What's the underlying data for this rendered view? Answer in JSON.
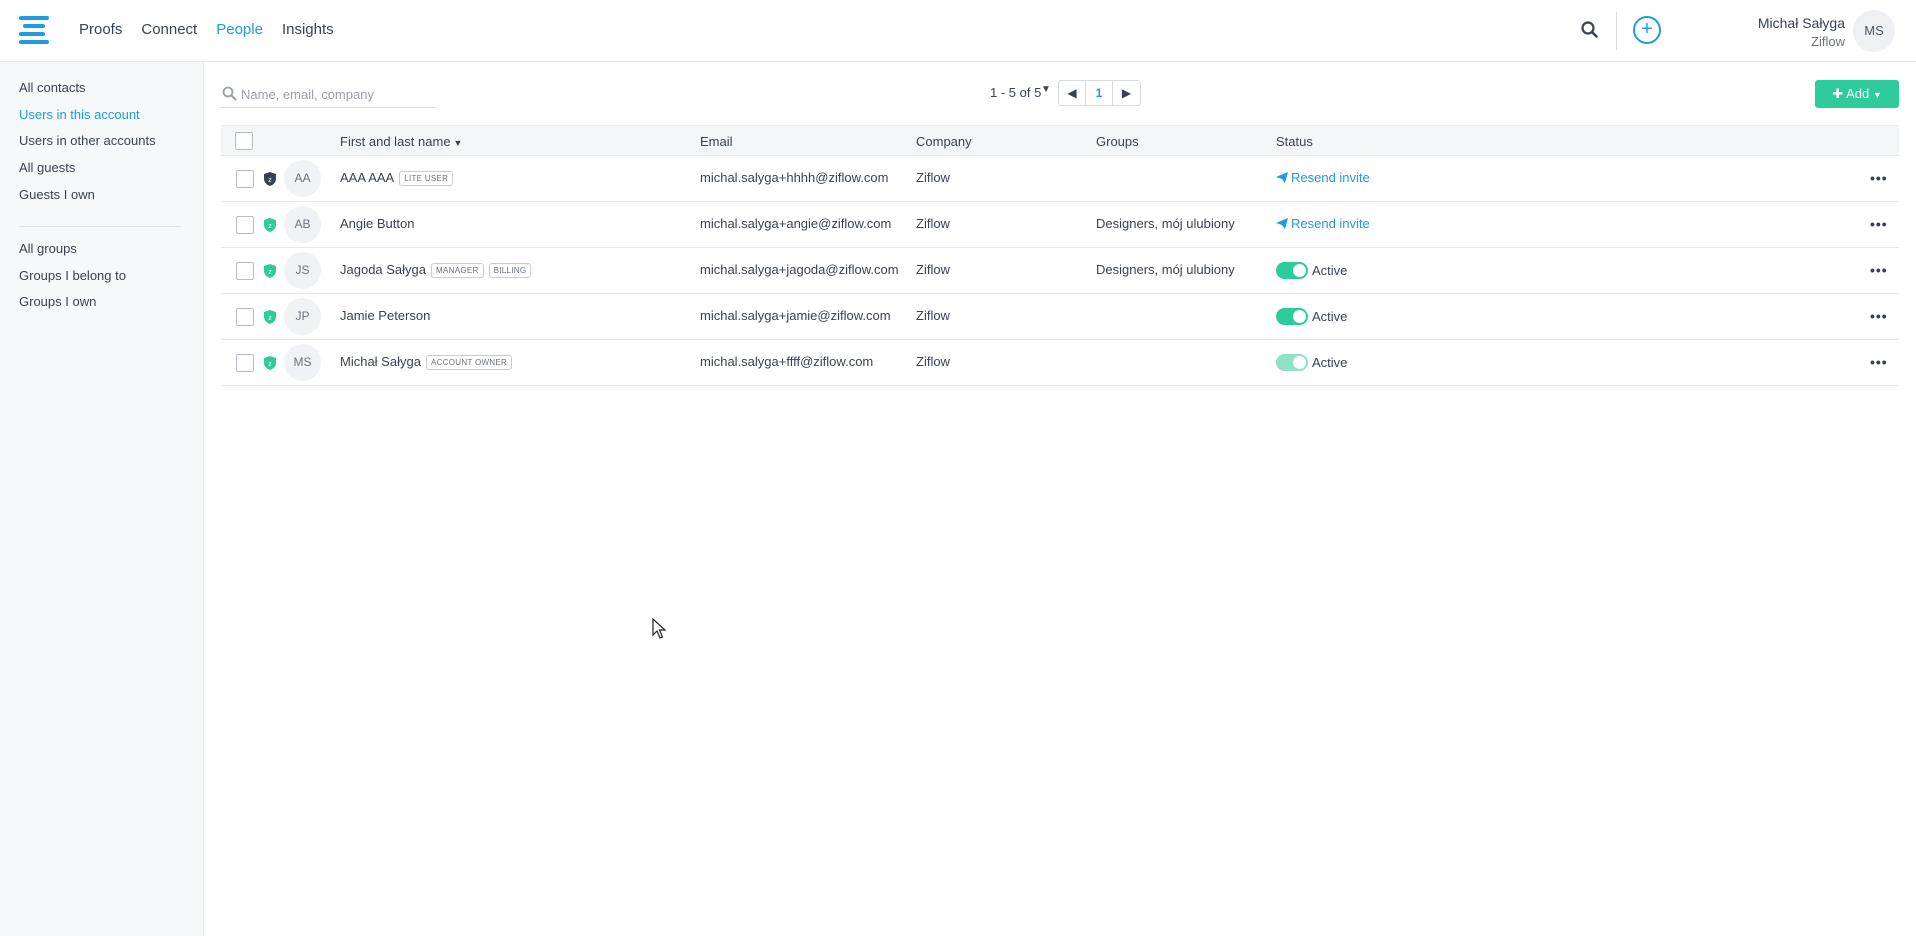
{
  "header": {
    "nav": [
      "Proofs",
      "Connect",
      "People",
      "Insights"
    ],
    "active_nav": "People",
    "user_name": "Michał Sałyga",
    "user_org": "Ziflow",
    "user_initials": "MS",
    "add_symbol": "+"
  },
  "sidebar": {
    "contacts": [
      "All contacts",
      "Users in this account",
      "Users in other accounts",
      "All guests",
      "Guests I own"
    ],
    "groups": [
      "All groups",
      "Groups I belong to",
      "Groups I own"
    ],
    "active": "Users in this account"
  },
  "toolbar": {
    "search_placeholder": "Name, email, company",
    "pager_text": "1 - 5 of 5",
    "current_page": "1",
    "add_label": "Add"
  },
  "table": {
    "headers": {
      "name": "First and last name",
      "email": "Email",
      "company": "Company",
      "groups": "Groups",
      "status": "Status"
    },
    "rows": [
      {
        "initials": "AA",
        "name": "AAA AAA",
        "badges": [
          "LITE USER"
        ],
        "email": "michal.salyga+hhhh@ziflow.com",
        "company": "Ziflow",
        "groups": "",
        "status": "Resend invite",
        "status_type": "invite",
        "shield": "dark"
      },
      {
        "initials": "AB",
        "name": "Angie Button",
        "badges": [],
        "email": "michal.salyga+angie@ziflow.com",
        "company": "Ziflow",
        "groups": "Designers, mój ulubiony",
        "status": "Resend invite",
        "status_type": "invite",
        "shield": "green"
      },
      {
        "initials": "JS",
        "name": "Jagoda Sałyga",
        "badges": [
          "MANAGER",
          "BILLING"
        ],
        "email": "michal.salyga+jagoda@ziflow.com",
        "company": "Ziflow",
        "groups": "Designers, mój ulubiony",
        "status": "Active",
        "status_type": "active",
        "shield": "green"
      },
      {
        "initials": "JP",
        "name": "Jamie Peterson",
        "badges": [],
        "email": "michal.salyga+jamie@ziflow.com",
        "company": "Ziflow",
        "groups": "",
        "status": "Active",
        "status_type": "active",
        "shield": "green"
      },
      {
        "initials": "MS",
        "name": "Michał Sałyga",
        "badges": [
          "ACCOUNT OWNER"
        ],
        "email": "michal.salyga+ffff@ziflow.com",
        "company": "Ziflow",
        "groups": "",
        "status": "Active",
        "status_type": "active-dim",
        "shield": "green"
      }
    ]
  },
  "colors": {
    "accent": "#1f9bde",
    "success": "#2ecc9a",
    "text": "#3a4250"
  }
}
